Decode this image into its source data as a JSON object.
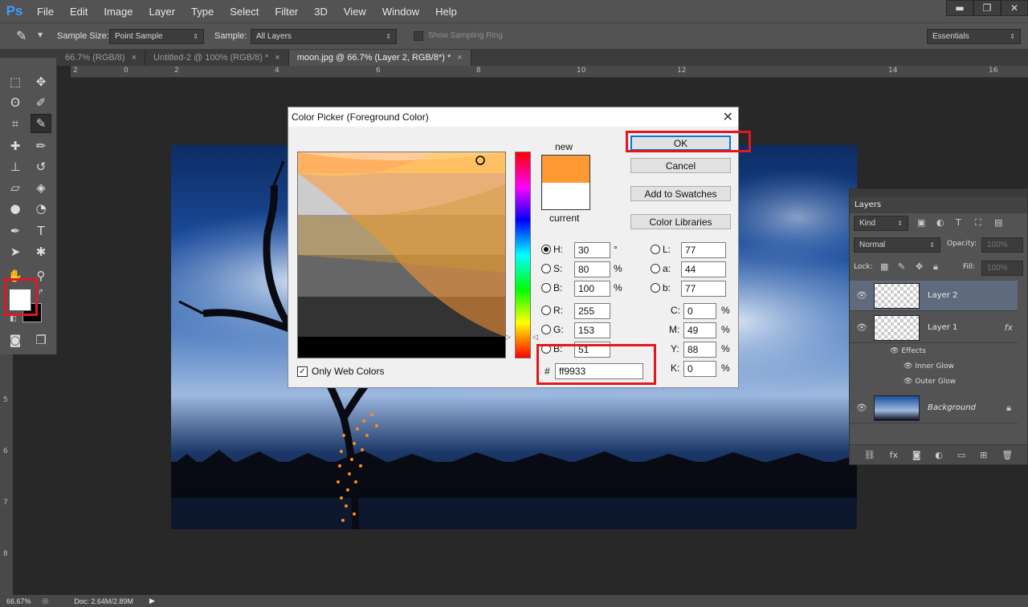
{
  "app": {
    "logo": "Ps"
  },
  "menu": [
    "File",
    "Edit",
    "Image",
    "Layer",
    "Type",
    "Select",
    "Filter",
    "3D",
    "View",
    "Window",
    "Help"
  ],
  "window_controls": {
    "minimize": "▬",
    "restore": "❐",
    "close": "✕"
  },
  "options_bar": {
    "sample_size_label": "Sample Size:",
    "sample_size_value": "Point Sample",
    "sample_label": "Sample:",
    "sample_value": "All Layers",
    "show_ring_label": "Show Sampling Ring",
    "workspace": "Essentials"
  },
  "tabs": [
    {
      "label": "66.7% (RGB/8)",
      "close": "×",
      "active": false
    },
    {
      "label": "Untitled-2 @ 100% (RGB/8) *",
      "close": "×",
      "active": false
    },
    {
      "label": "moon.jpg @ 66.7% (Layer 2, RGB/8*) *",
      "close": "×",
      "active": true
    }
  ],
  "ruler": {
    "h": [
      "2",
      "0",
      "2",
      "4",
      "6",
      "8",
      "10",
      "12",
      "14",
      "16"
    ],
    "v": [
      "5",
      "6",
      "7",
      "8"
    ]
  },
  "status": {
    "zoom": "66.67%",
    "doc": "Doc: 2.64M/2.89M"
  },
  "dialog": {
    "title": "Color Picker (Foreground Color)",
    "new_label": "new",
    "current_label": "current",
    "new_color": "#ff9933",
    "current_color": "#ffffff",
    "buttons": {
      "ok": "OK",
      "cancel": "Cancel",
      "add_swatches": "Add to Swatches",
      "libraries": "Color Libraries"
    },
    "only_web_colors": "Only Web Colors",
    "fields": {
      "H": {
        "label": "H:",
        "value": "30",
        "unit": "°"
      },
      "S": {
        "label": "S:",
        "value": "80",
        "unit": "%"
      },
      "B": {
        "label": "B:",
        "value": "100",
        "unit": "%"
      },
      "R": {
        "label": "R:",
        "value": "255"
      },
      "G": {
        "label": "G:",
        "value": "153"
      },
      "Bl": {
        "label": "B:",
        "value": "51"
      },
      "L": {
        "label": "L:",
        "value": "77"
      },
      "a": {
        "label": "a:",
        "value": "44"
      },
      "b": {
        "label": "b:",
        "value": "77"
      },
      "C": {
        "label": "C:",
        "value": "0",
        "unit": "%"
      },
      "M": {
        "label": "M:",
        "value": "49",
        "unit": "%"
      },
      "Y": {
        "label": "Y:",
        "value": "88",
        "unit": "%"
      },
      "K": {
        "label": "K:",
        "value": "0",
        "unit": "%"
      }
    },
    "hex_label": "#",
    "hex_value": "ff9933"
  },
  "layers_panel": {
    "title": "Layers",
    "kind": "Kind",
    "blend": "Normal",
    "opacity_label": "Opacity:",
    "opacity_value": "100%",
    "lock_label": "Lock:",
    "fill_label": "Fill:",
    "fill_value": "100%",
    "layers": [
      {
        "name": "Layer 2"
      },
      {
        "name": "Layer 1",
        "fx": "fx"
      },
      {
        "name": "Effects"
      },
      {
        "name": "Inner Glow"
      },
      {
        "name": "Outer Glow"
      },
      {
        "name": "Background"
      }
    ]
  }
}
